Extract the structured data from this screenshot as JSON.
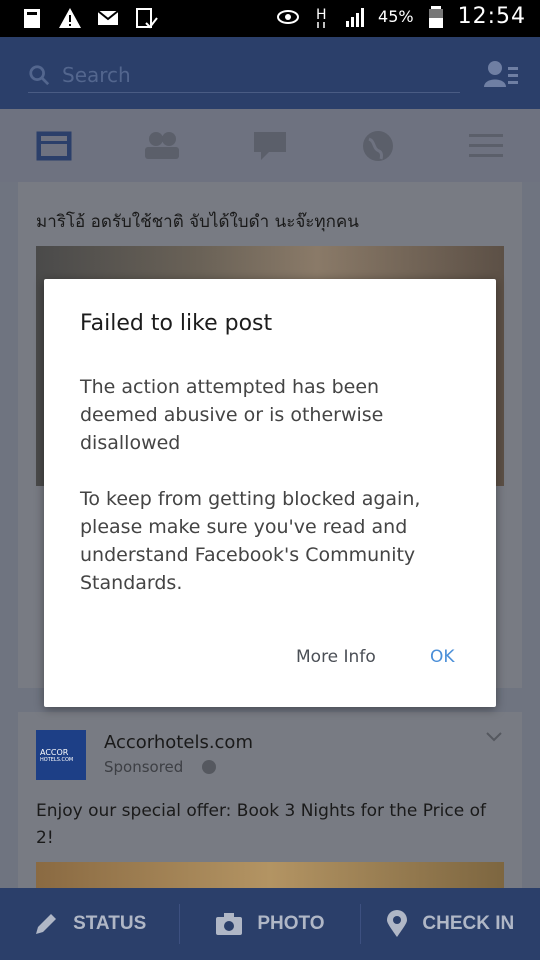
{
  "status_bar": {
    "battery_percent": "45%",
    "time": "12:54",
    "icons": [
      "notification-icon",
      "warning-icon",
      "mail-icon",
      "clipboard-check-icon",
      "eye-icon",
      "network-h-icon",
      "signal-icon",
      "battery-icon"
    ]
  },
  "header": {
    "search_placeholder": "Search"
  },
  "tabs": [
    "news-feed-icon",
    "friends-icon",
    "messages-icon",
    "notifications-globe-icon",
    "menu-icon"
  ],
  "feed": {
    "post1": {
      "text": "มาริโอ้ อดรับใช้ชาติ จับได้ใบดำ นะจ๊ะทุกคน"
    },
    "post2": {
      "page_name": "Accorhotels.com",
      "sponsored": "Sponsored",
      "logo_text": "ACCOR",
      "logo_sub": "HOTELS.COM",
      "text": "Enjoy our special offer: Book 3 Nights for the Price of 2!"
    }
  },
  "bottom_bar": {
    "status_label": "STATUS",
    "photo_label": "PHOTO",
    "checkin_label": "CHECK IN"
  },
  "dialog": {
    "title": "Failed to like post",
    "message": "The action attempted has been deemed abusive or is otherwise disallowed\n\nTo keep from getting blocked again, please make sure you've read and understand Facebook's Community Standards.",
    "more_info_label": "More Info",
    "ok_label": "OK"
  },
  "colors": {
    "header_blue": "#2b3f6a",
    "link_blue": "#4b8fd8"
  }
}
